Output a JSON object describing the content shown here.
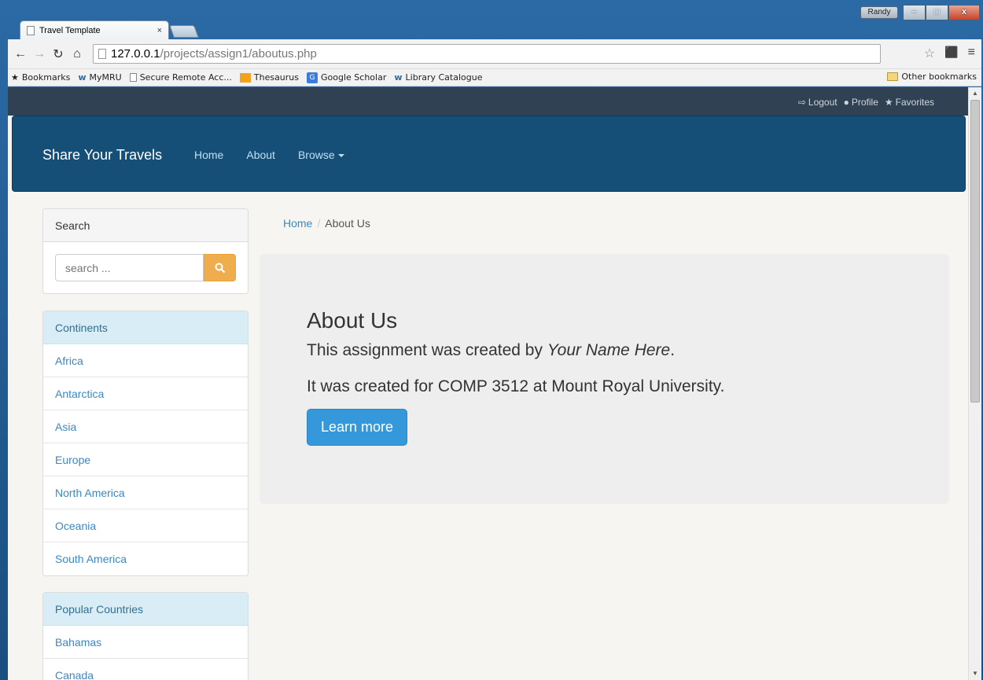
{
  "browser": {
    "tab_title": "Travel Template",
    "tab_close": "×",
    "user_badge": "Randy",
    "url_host": "127.0.0.1",
    "url_path": "/projects/assign1/aboutus.php",
    "bookmarks": [
      {
        "label": "Bookmarks"
      },
      {
        "label": "MyMRU"
      },
      {
        "label": "Secure Remote Acc..."
      },
      {
        "label": "Thesaurus"
      },
      {
        "label": "Google Scholar"
      },
      {
        "label": "Library Catalogue"
      }
    ],
    "other_bookmarks": "Other bookmarks"
  },
  "top_strip": {
    "logout": "Logout",
    "profile": "Profile",
    "favorites": "Favorites"
  },
  "navbar": {
    "brand": "Share Your Travels",
    "links": [
      "Home",
      "About",
      "Browse"
    ]
  },
  "sidebar": {
    "search": {
      "heading": "Search",
      "placeholder": "search ..."
    },
    "continents": {
      "heading": "Continents",
      "items": [
        "Africa",
        "Antarctica",
        "Asia",
        "Europe",
        "North America",
        "Oceania",
        "South America"
      ]
    },
    "countries": {
      "heading": "Popular Countries",
      "items": [
        "Bahamas",
        "Canada"
      ]
    }
  },
  "breadcrumb": {
    "home": "Home",
    "separator": "/",
    "current": "About Us"
  },
  "jumbotron": {
    "title": "About Us",
    "line1_prefix": "This assignment was created by ",
    "line1_name": "Your Name Here",
    "line1_suffix": ".",
    "line2": "It was created for COMP 3512 at Mount Royal University.",
    "button": "Learn more"
  }
}
